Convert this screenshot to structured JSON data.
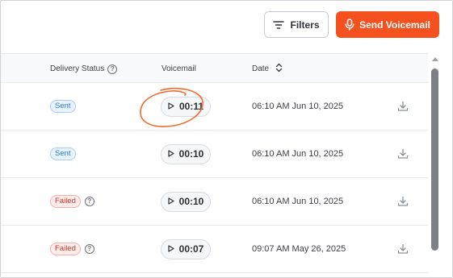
{
  "toolbar": {
    "filters_label": "Filters",
    "send_label": "Send Voicemail",
    "filters_icon": "filter-lines-icon",
    "send_icon": "microphone-icon"
  },
  "colors": {
    "accent": "#f4511e",
    "sent_badge": "#2a7bd6",
    "failed_badge": "#c0392b",
    "annotation": "#f26a2e"
  },
  "table": {
    "headers": {
      "delivery_status": "Delivery Status",
      "voicemail": "Voicemail",
      "date": "Date"
    },
    "rows": [
      {
        "status": "Sent",
        "status_type": "sent",
        "duration": "00:11",
        "date": "06:10 AM Jun 10, 2025"
      },
      {
        "status": "Sent",
        "status_type": "sent",
        "duration": "00:10",
        "date": "06:10 AM Jun 10, 2025"
      },
      {
        "status": "Failed",
        "status_type": "failed",
        "duration": "00:10",
        "date": "06:10 AM Jun 10, 2025"
      },
      {
        "status": "Failed",
        "status_type": "failed",
        "duration": "00:07",
        "date": "09:07 AM May 26, 2025"
      }
    ]
  }
}
